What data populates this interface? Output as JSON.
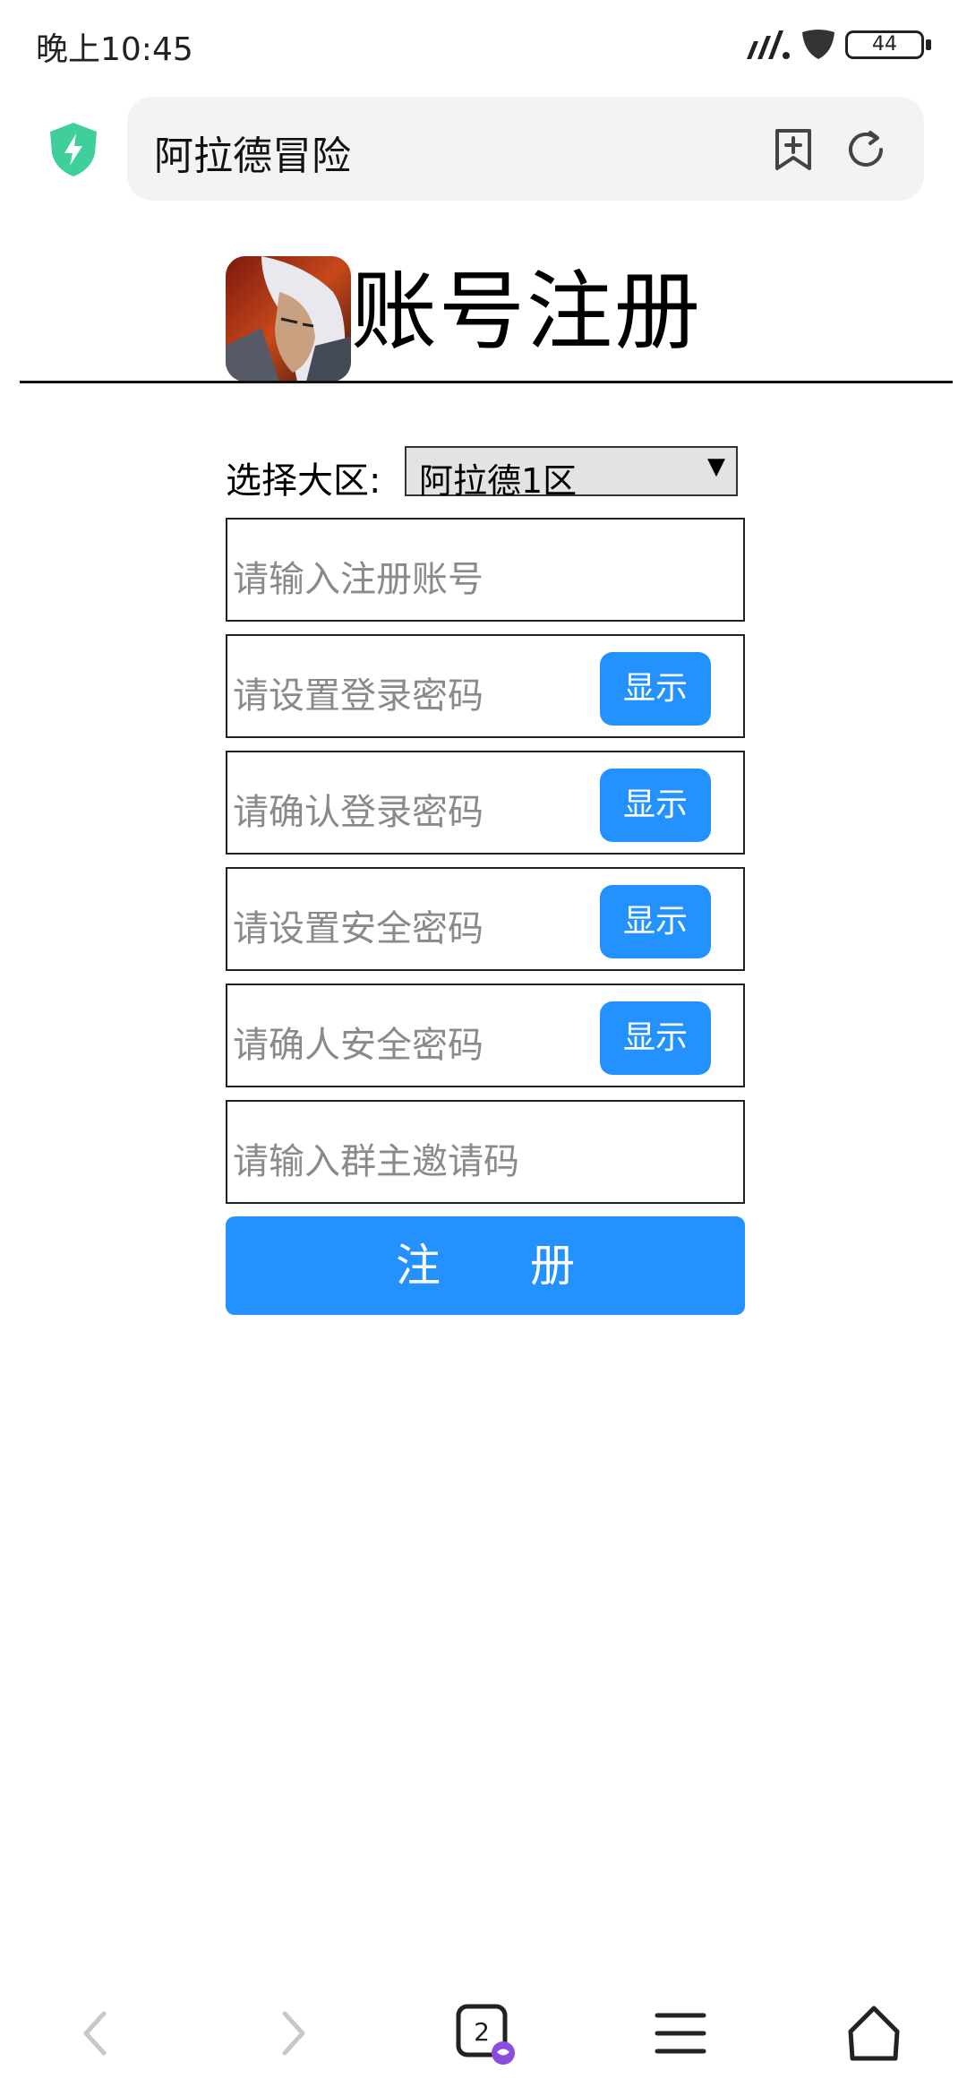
{
  "status_bar": {
    "time": "晚上10:45",
    "battery": "44"
  },
  "browser": {
    "address_text": "阿拉德冒险",
    "security_icon": "shield-bolt-icon",
    "bookmark_icon": "bookmark-add-icon",
    "reload_icon": "reload-icon"
  },
  "header": {
    "title": "账号注册",
    "logo": "game-logo"
  },
  "form": {
    "region_label": "选择大区:",
    "region_selected": "阿拉德1区",
    "fields": [
      {
        "placeholder": "请输入注册账号"
      },
      {
        "placeholder": "请设置登录密码",
        "button": "显示"
      },
      {
        "placeholder": "请确认登录密码",
        "button": "显示"
      },
      {
        "placeholder": "请设置安全密码",
        "button": "显示"
      },
      {
        "placeholder": "请确人安全密码",
        "button": "显示"
      },
      {
        "placeholder": "请输入群主邀请码"
      }
    ],
    "submit_label": "注　　册"
  },
  "bottom_nav": {
    "tab_count": "2",
    "items": [
      "back-icon",
      "forward-icon",
      "tabs-icon",
      "menu-icon",
      "home-icon"
    ]
  },
  "colors": {
    "accent": "#2392ff",
    "shield": "#3ecf9a"
  }
}
